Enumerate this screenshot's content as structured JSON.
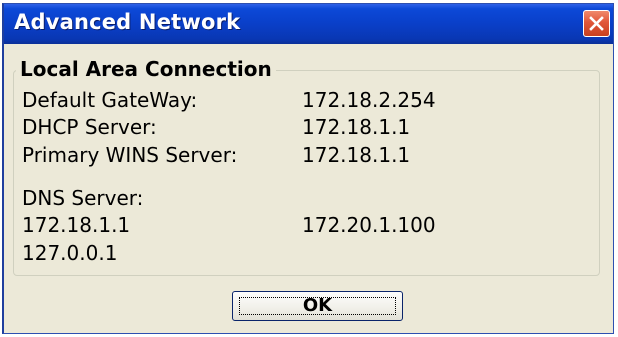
{
  "window": {
    "title": "Advanced Network",
    "close_icon": "close-icon"
  },
  "group": {
    "title": "Local Area Connection",
    "rows": [
      {
        "label": "Default GateWay:",
        "value": "172.18.2.254"
      },
      {
        "label": "DHCP Server:",
        "value": "172.18.1.1"
      },
      {
        "label": "Primary WINS Server:",
        "value": "172.18.1.1"
      }
    ],
    "dns": {
      "label": "DNS Server:",
      "servers": [
        "172.18.1.1",
        "172.20.1.100",
        "127.0.0.1"
      ]
    }
  },
  "buttons": {
    "ok_label": "OK"
  },
  "colors": {
    "titlebar": "#0a3fc8",
    "window_bg": "#ece9d8",
    "close_button": "#e1573a"
  }
}
